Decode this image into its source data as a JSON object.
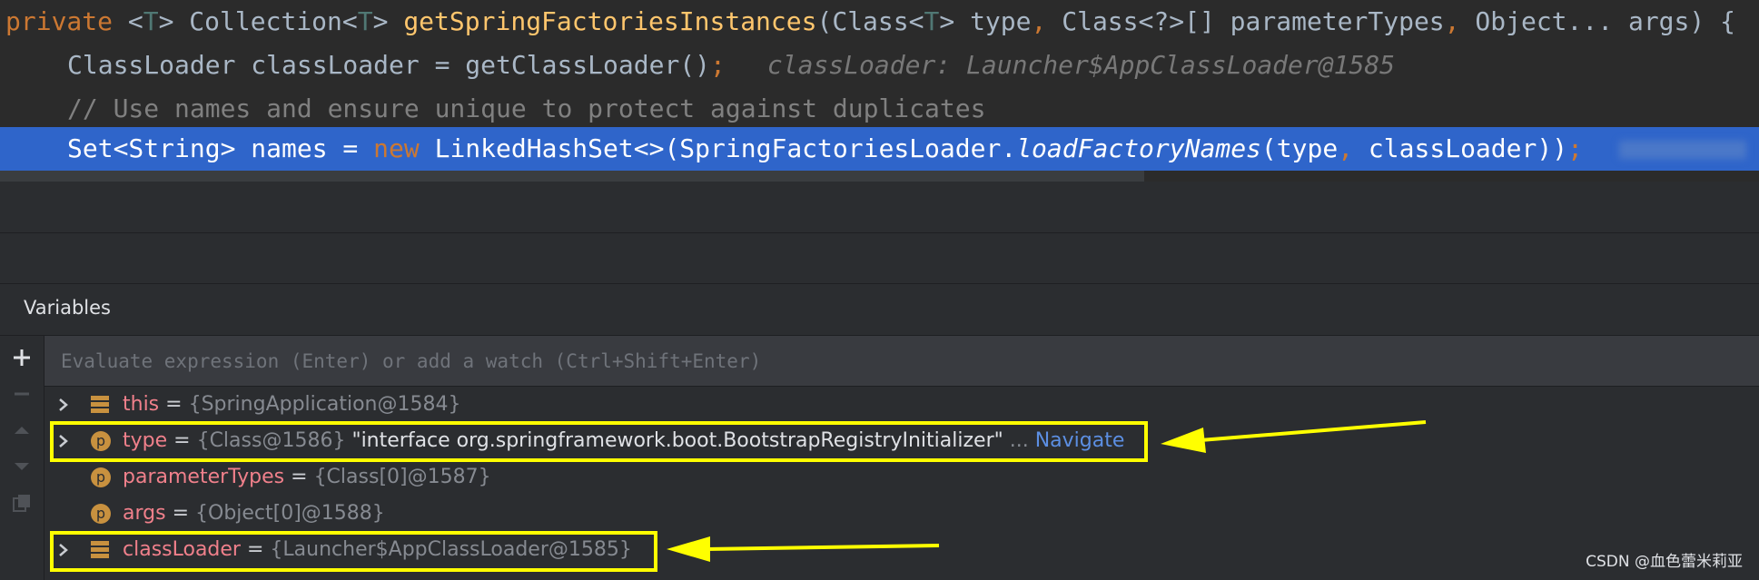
{
  "editor": {
    "line1": {
      "kw_private": "private",
      "tp_open": "<",
      "tp_T": "T",
      "tp_close": ">",
      "ret": " Collection<",
      "ret_T": "T",
      "ret_close": "> ",
      "method": "getSpringFactoriesInstances",
      "params_a": "(Class<",
      "params_T": "T",
      "params_b": "> type",
      "comma1": ",",
      "params_c": " Class<?>[] parameterTypes",
      "comma2": ",",
      "params_d": " Object... args) {"
    },
    "line2": {
      "code": "ClassLoader classLoader = getClassLoader()",
      "semi": ";",
      "hint": "classLoader: Launcher$AppClassLoader@1585"
    },
    "line3": {
      "comment": "// Use names and ensure unique to protect against duplicates"
    },
    "line4": {
      "a": "Set<String> names = ",
      "kw_new": "new",
      "b": " LinkedHashSet<>(SpringFactoriesLoader.",
      "method": "loadFactoryNames",
      "c": "(type",
      "comma": ",",
      "d": " classLoader))",
      "semi": ";"
    }
  },
  "panel": {
    "title": "Variables",
    "eval_placeholder": "Evaluate expression (Enter) or add a watch (Ctrl+Shift+Enter)",
    "toolbar_icons": [
      "plus-icon",
      "minus-icon",
      "arrow-up-icon",
      "arrow-down-icon",
      "copy-icon"
    ],
    "variables": [
      {
        "name": "this",
        "eq": " = ",
        "value": "{SpringApplication@1584}",
        "icon": "field-icon",
        "expandable": true
      },
      {
        "name": "type",
        "eq": " = ",
        "value": "{Class@1586}",
        "str": " \"interface org.springframework.boot.BootstrapRegistryInitializer\"",
        "dots": " ...",
        "nav": " Navigate",
        "icon": "param-icon",
        "expandable": true
      },
      {
        "name": "parameterTypes",
        "eq": " = ",
        "value": "{Class[0]@1587}",
        "icon": "param-icon",
        "expandable": false
      },
      {
        "name": "args",
        "eq": " = ",
        "value": "{Object[0]@1588}",
        "icon": "param-icon",
        "expandable": false
      },
      {
        "name": "classLoader",
        "eq": " = ",
        "value": "{Launcher$AppClassLoader@1585}",
        "icon": "field-icon",
        "expandable": true
      }
    ],
    "param_letter": "p"
  },
  "watermark": "CSDN @血色蕾米莉亚",
  "colors": {
    "highlight": "#ffff00",
    "selection": "#2f65ca",
    "keyword": "#cc7832",
    "method": "#ffc66d",
    "var_name": "#f0808b"
  }
}
